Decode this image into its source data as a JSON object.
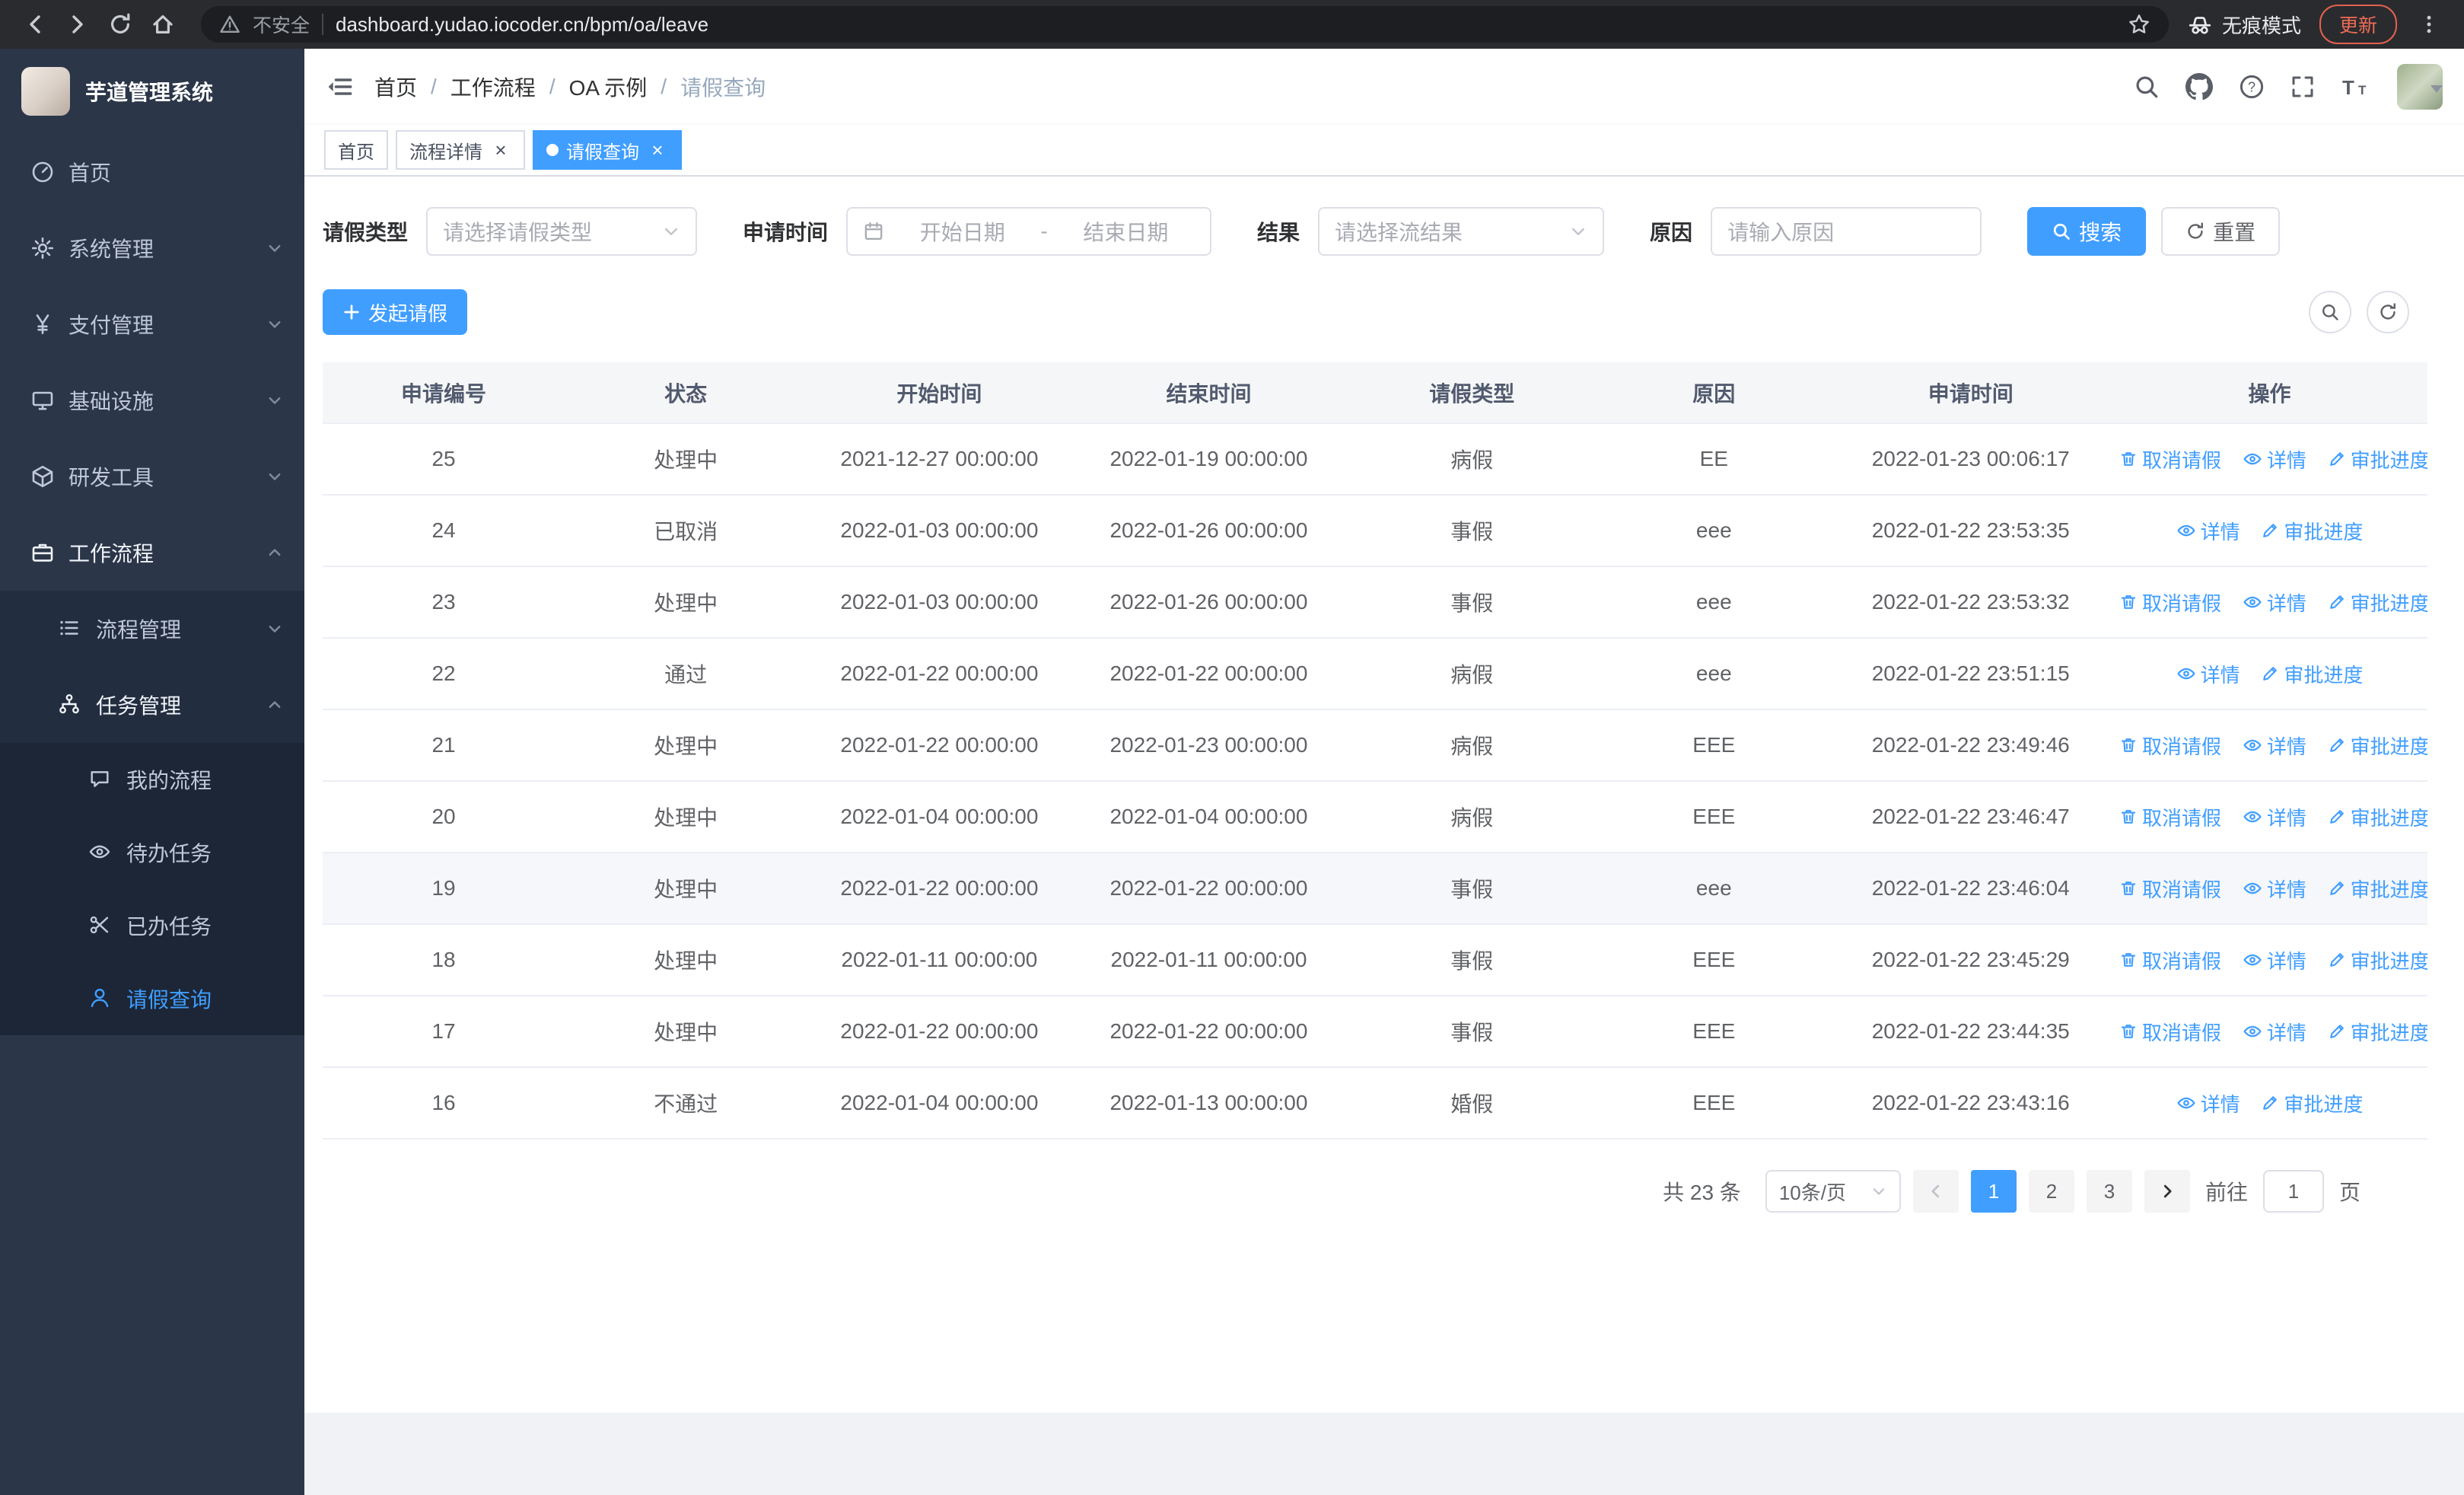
{
  "colors": {
    "primary": "#409eff",
    "update_badge": "#ef6c57",
    "sidebar_bg": "#2b3649"
  },
  "browser": {
    "security_label": "不安全",
    "url": "dashboard.yudao.iocoder.cn/bpm/oa/leave",
    "incognito_label": "无痕模式",
    "update_label": "更新"
  },
  "sidebar": {
    "title": "芋道管理系统",
    "items_l1": [
      {
        "label": "首页"
      },
      {
        "label": "系统管理"
      },
      {
        "label": "支付管理"
      },
      {
        "label": "基础设施"
      },
      {
        "label": "研发工具"
      },
      {
        "label": "工作流程"
      }
    ],
    "workflow_children": [
      {
        "label": "流程管理"
      },
      {
        "label": "任务管理"
      }
    ],
    "task_children": [
      {
        "label": "我的流程"
      },
      {
        "label": "待办任务"
      },
      {
        "label": "已办任务"
      },
      {
        "label": "请假查询"
      }
    ]
  },
  "header": {
    "breadcrumb": [
      "首页",
      "工作流程",
      "OA 示例",
      "请假查询"
    ]
  },
  "tabs": [
    {
      "label": "首页"
    },
    {
      "label": "流程详情"
    },
    {
      "label": "请假查询"
    }
  ],
  "filters": {
    "leave_type_label": "请假类型",
    "leave_type_placeholder": "请选择请假类型",
    "apply_time_label": "申请时间",
    "start_date_placeholder": "开始日期",
    "range_separator": "-",
    "end_date_placeholder": "结束日期",
    "result_label": "结果",
    "result_placeholder": "请选择流结果",
    "reason_label": "原因",
    "reason_placeholder": "请输入原因",
    "search_label": "搜索",
    "reset_label": "重置"
  },
  "toolbar": {
    "create_label": "发起请假"
  },
  "table": {
    "columns": [
      "申请编号",
      "状态",
      "开始时间",
      "结束时间",
      "请假类型",
      "原因",
      "申请时间",
      "操作"
    ],
    "actions": {
      "cancel": "取消请假",
      "detail": "详情",
      "progress": "审批进度"
    },
    "rows": [
      {
        "id": "25",
        "status": "处理中",
        "start": "2021-12-27 00:00:00",
        "end": "2022-01-19 00:00:00",
        "type": "病假",
        "reason": "EE",
        "applied": "2022-01-23 00:06:17",
        "cancelable": true
      },
      {
        "id": "24",
        "status": "已取消",
        "start": "2022-01-03 00:00:00",
        "end": "2022-01-26 00:00:00",
        "type": "事假",
        "reason": "eee",
        "applied": "2022-01-22 23:53:35",
        "cancelable": false
      },
      {
        "id": "23",
        "status": "处理中",
        "start": "2022-01-03 00:00:00",
        "end": "2022-01-26 00:00:00",
        "type": "事假",
        "reason": "eee",
        "applied": "2022-01-22 23:53:32",
        "cancelable": true
      },
      {
        "id": "22",
        "status": "通过",
        "start": "2022-01-22 00:00:00",
        "end": "2022-01-22 00:00:00",
        "type": "病假",
        "reason": "eee",
        "applied": "2022-01-22 23:51:15",
        "cancelable": false
      },
      {
        "id": "21",
        "status": "处理中",
        "start": "2022-01-22 00:00:00",
        "end": "2022-01-23 00:00:00",
        "type": "病假",
        "reason": "EEE",
        "applied": "2022-01-22 23:49:46",
        "cancelable": true
      },
      {
        "id": "20",
        "status": "处理中",
        "start": "2022-01-04 00:00:00",
        "end": "2022-01-04 00:00:00",
        "type": "病假",
        "reason": "EEE",
        "applied": "2022-01-22 23:46:47",
        "cancelable": true
      },
      {
        "id": "19",
        "status": "处理中",
        "start": "2022-01-22 00:00:00",
        "end": "2022-01-22 00:00:00",
        "type": "事假",
        "reason": "eee",
        "applied": "2022-01-22 23:46:04",
        "cancelable": true,
        "highlighted": true
      },
      {
        "id": "18",
        "status": "处理中",
        "start": "2022-01-11 00:00:00",
        "end": "2022-01-11 00:00:00",
        "type": "事假",
        "reason": "EEE",
        "applied": "2022-01-22 23:45:29",
        "cancelable": true
      },
      {
        "id": "17",
        "status": "处理中",
        "start": "2022-01-22 00:00:00",
        "end": "2022-01-22 00:00:00",
        "type": "事假",
        "reason": "EEE",
        "applied": "2022-01-22 23:44:35",
        "cancelable": true
      },
      {
        "id": "16",
        "status": "不通过",
        "start": "2022-01-04 00:00:00",
        "end": "2022-01-13 00:00:00",
        "type": "婚假",
        "reason": "EEE",
        "applied": "2022-01-22 23:43:16",
        "cancelable": false
      }
    ]
  },
  "pagination": {
    "total_label": "共 23 条",
    "page_size_label": "10条/页",
    "pages": [
      "1",
      "2",
      "3"
    ],
    "active_page": "1",
    "goto_label": "前往",
    "goto_value": "1",
    "page_suffix_label": "页"
  },
  "icons": {
    "row_actions": [
      "trash",
      "eye",
      "edit-pen"
    ],
    "header_right": [
      "search",
      "github",
      "help",
      "fullscreen",
      "text-size"
    ],
    "browser": [
      "back",
      "forward",
      "reload",
      "home",
      "warning",
      "star",
      "incognito",
      "kebab-menu"
    ]
  }
}
